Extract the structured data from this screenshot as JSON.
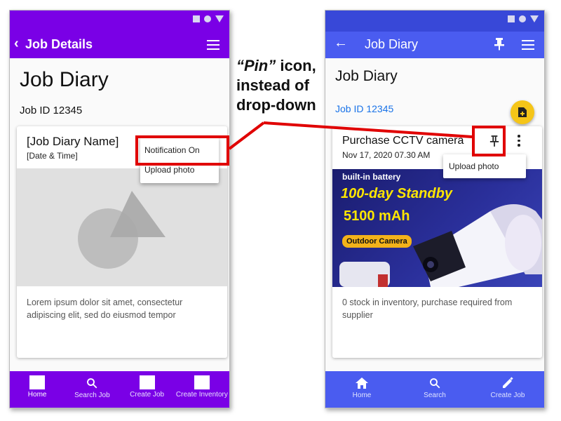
{
  "left": {
    "appbar_title": "Job Details",
    "page_title": "Job Diary",
    "job_id": "Job ID 12345",
    "card": {
      "title": "[Job Diary Name]",
      "subtitle": "[Date & Time]",
      "body": "Lorem ipsum dolor sit amet, consectetur adipiscing elit, sed do eiusmod tempor"
    },
    "menu": [
      "Notification On",
      "Upload photo"
    ],
    "nav": [
      "Home",
      "Search Job",
      "Create Job",
      "Create Inventory"
    ]
  },
  "right": {
    "appbar_title": "Job Diary",
    "page_title": "Job Diary",
    "job_id": "Job ID 12345",
    "card": {
      "title": "Purchase CCTV camera",
      "subtitle": "Nov 17, 2020 07.30 AM",
      "body": "0 stock in inventory, purchase required from supplier"
    },
    "menu": [
      "Upload photo"
    ],
    "ad": {
      "line1": "built-in battery",
      "line2": "100-day Standby",
      "line3": "5100 mAh",
      "badge": "Outdoor Camera"
    },
    "nav": [
      "Home",
      "Search",
      "Create Job"
    ]
  },
  "annotation": {
    "pin_word": "“Pin”",
    "rest": " icon, instead of drop-down"
  },
  "colors": {
    "left_bar": "#7a00e6",
    "right_bar": "#4a5cf0",
    "highlight": "#e00000",
    "link": "#1a73e8",
    "fab": "#f5c518"
  },
  "icons": [
    "back-chevron-icon",
    "menu-icon",
    "back-arrow-icon",
    "pin-icon",
    "more-vert-icon",
    "note-add-icon",
    "home-icon",
    "search-icon",
    "edit-icon"
  ]
}
